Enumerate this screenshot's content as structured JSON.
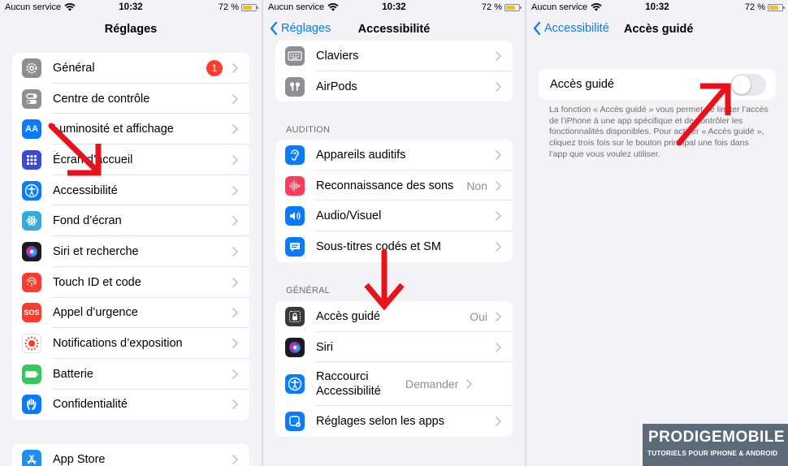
{
  "status_bar": {
    "carrier": "Aucun service",
    "time": "10:32",
    "battery": "72 %",
    "battery_level": 0.72
  },
  "panel1": {
    "title": "Réglages",
    "group1": [
      {
        "label": "Général",
        "badge": "1",
        "icon": "gear-icon",
        "color": "#8e8e93"
      },
      {
        "label": "Centre de contrôle",
        "icon": "switches-icon",
        "color": "#8e8e93"
      },
      {
        "label": "Luminosité et affichage",
        "icon": "text-size-icon",
        "color": "#0a7aff"
      },
      {
        "label": "Écran d’accueil",
        "icon": "home-grid-icon",
        "color": "#3a4bd6"
      },
      {
        "label": "Accessibilité",
        "icon": "accessibility-icon",
        "color": "#0a7aff"
      },
      {
        "label": "Fond d’écran",
        "icon": "flower-icon",
        "color": "#35aadc"
      },
      {
        "label": "Siri et recherche",
        "icon": "siri-icon",
        "color": "#1c1c1e"
      },
      {
        "label": "Touch ID et code",
        "icon": "fingerprint-icon",
        "color": "#ff3b30"
      },
      {
        "label": "Appel d’urgence",
        "icon": "sos-icon",
        "color": "#ff3b30",
        "icon_text": "SOS"
      },
      {
        "label": "Notifications d’exposition",
        "icon": "exposure-icon",
        "color": "#ffffff"
      },
      {
        "label": "Batterie",
        "icon": "battery-icon",
        "color": "#34c759"
      },
      {
        "label": "Confidentialité",
        "icon": "hand-icon",
        "color": "#0a7aff"
      }
    ],
    "group2": [
      {
        "label": "App Store",
        "icon": "appstore-icon",
        "color": "#1e8ef5"
      }
    ]
  },
  "panel2": {
    "back": "Réglages",
    "title": "Accessibilité",
    "group1": [
      {
        "label": "Claviers",
        "icon": "keyboard-icon",
        "color": "#8e8e93"
      },
      {
        "label": "AirPods",
        "icon": "airpods-icon",
        "color": "#8e8e93"
      }
    ],
    "section_audition": "AUDITION",
    "group2": [
      {
        "label": "Appareils auditifs",
        "icon": "ear-icon",
        "color": "#0a7aff"
      },
      {
        "label": "Reconnaissance des sons",
        "value": "Non",
        "icon": "sound-wave-icon",
        "color": "#ff3b5c"
      },
      {
        "label": "Audio/Visuel",
        "icon": "speaker-eye-icon",
        "color": "#0a7aff"
      },
      {
        "label": "Sous-titres codés et SM",
        "icon": "captions-icon",
        "color": "#0a7aff"
      }
    ],
    "section_general": "GÉNÉRAL",
    "group3": [
      {
        "label": "Accès guidé",
        "value": "Oui",
        "icon": "lock-icon",
        "color": "#3a3a3c"
      },
      {
        "label": "Siri",
        "icon": "siri-icon",
        "color": "#1c1c1e"
      },
      {
        "label": "Raccourci Accessibilité",
        "value": "Demander",
        "icon": "accessibility-icon",
        "color": "#0a7aff"
      },
      {
        "label": "Réglages selon les apps",
        "icon": "app-settings-icon",
        "color": "#0a7aff"
      }
    ]
  },
  "panel3": {
    "back": "Accessibilité",
    "title": "Accès guidé",
    "toggle_label": "Accès guidé",
    "toggle_on": false,
    "footer": "La fonction « Accès guidé » vous permet de limiter l’accès de l’iPhone à une app spécifique et de contrôler les fonctionnalités disponibles. Pour activer « Accès guidé », cliquez trois fois sur le bouton principal une fois dans l’app que vous voulez utiliser."
  },
  "logo": {
    "brand": "PRODIGEMOBILE",
    "tagline": "TUTORIELS POUR IPHONE & ANDROID"
  },
  "colors": {
    "accent": "#0a7aff",
    "arrow": "#e8121a",
    "badge": "#ff3b30",
    "background": "#f2f2f7"
  }
}
